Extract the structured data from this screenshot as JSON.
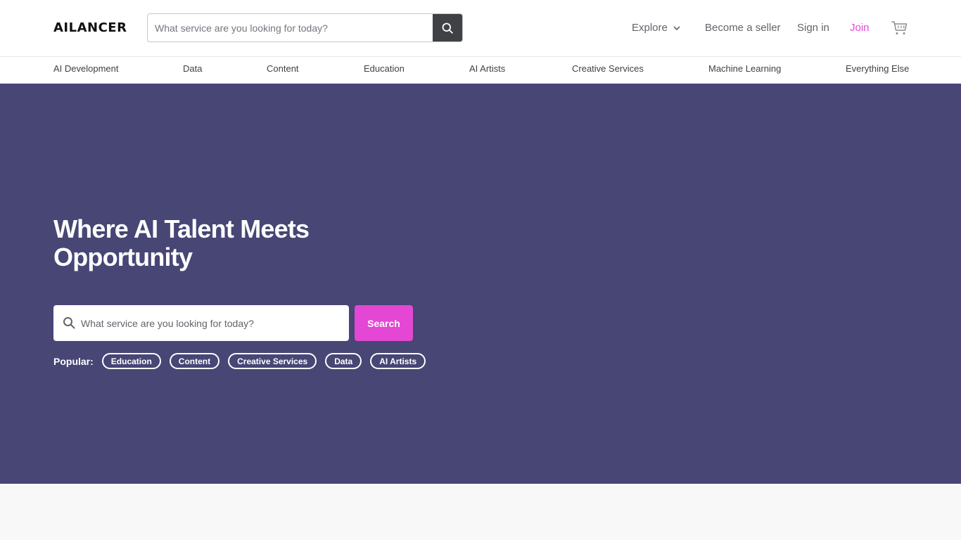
{
  "brand": {
    "logo_text": "AILANCER",
    "accent": "#e447d3",
    "hero_bg": "#474675"
  },
  "header": {
    "search_placeholder": "What service are you looking for today?",
    "search_icon": "search-icon",
    "explore": "Explore",
    "become_seller": "Become a seller",
    "sign_in": "Sign in",
    "join": "Join",
    "cart_icon": "cart-icon"
  },
  "categories": [
    "AI Development",
    "Data",
    "Content",
    "Education",
    "AI Artists",
    "Creative Services",
    "Machine Learning",
    "Everything Else"
  ],
  "hero": {
    "title": "Where AI Talent Meets Opportunity",
    "search_placeholder": "What service are you looking for today?",
    "search_button": "Search",
    "popular_label": "Popular:",
    "popular_tags": [
      "Education",
      "Content",
      "Creative Services",
      "Data",
      "AI Artists"
    ]
  }
}
